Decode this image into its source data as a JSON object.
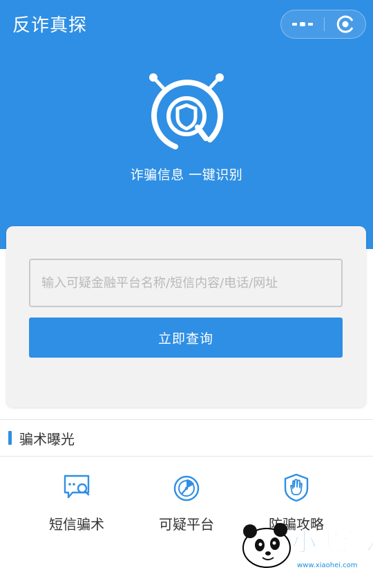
{
  "header": {
    "app_title": "反诈真探"
  },
  "capsule": {
    "more_icon": "more-dots-icon",
    "close_icon": "close-target-icon"
  },
  "hero": {
    "logo_icon": "shield-search-logo",
    "slogan": "诈骗信息 一键识别"
  },
  "search": {
    "placeholder": "输入可疑金融平台名称/短信内容/电话/网址",
    "value": "",
    "button_label": "立即查询"
  },
  "section": {
    "title": "骗术曝光"
  },
  "categories": [
    {
      "label": "短信骗术",
      "icon": "sms-search-icon"
    },
    {
      "label": "可疑平台",
      "icon": "radar-icon"
    },
    {
      "label": "防骗攻略",
      "icon": "hand-shield-icon"
    }
  ],
  "watermark": {
    "text": "小黑游戏",
    "url_text": "www.xiaohei.com"
  },
  "colors": {
    "primary": "#2f8fe4",
    "card_bg": "#f2f2f2",
    "text": "#333333"
  }
}
